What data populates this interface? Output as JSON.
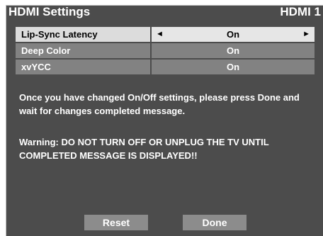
{
  "header": {
    "title": "HDMI Settings",
    "input_name": "HDMI 1"
  },
  "settings": [
    {
      "label": "Lip-Sync Latency",
      "value": "On",
      "selected": true
    },
    {
      "label": "Deep Color",
      "value": "On",
      "selected": false
    },
    {
      "label": "xvYCC",
      "value": "On",
      "selected": false
    }
  ],
  "arrows": {
    "left": "◄",
    "right": "►"
  },
  "messages": {
    "instruction": "Once you have changed On/Off settings, please press Done and wait for changes completed message.",
    "warning": "Warning: DO NOT TURN OFF OR UNPLUG THE TV UNTIL COMPLETED MESSAGE IS DISPLAYED!!"
  },
  "buttons": {
    "reset_label": "Reset",
    "done_label": "Done"
  }
}
